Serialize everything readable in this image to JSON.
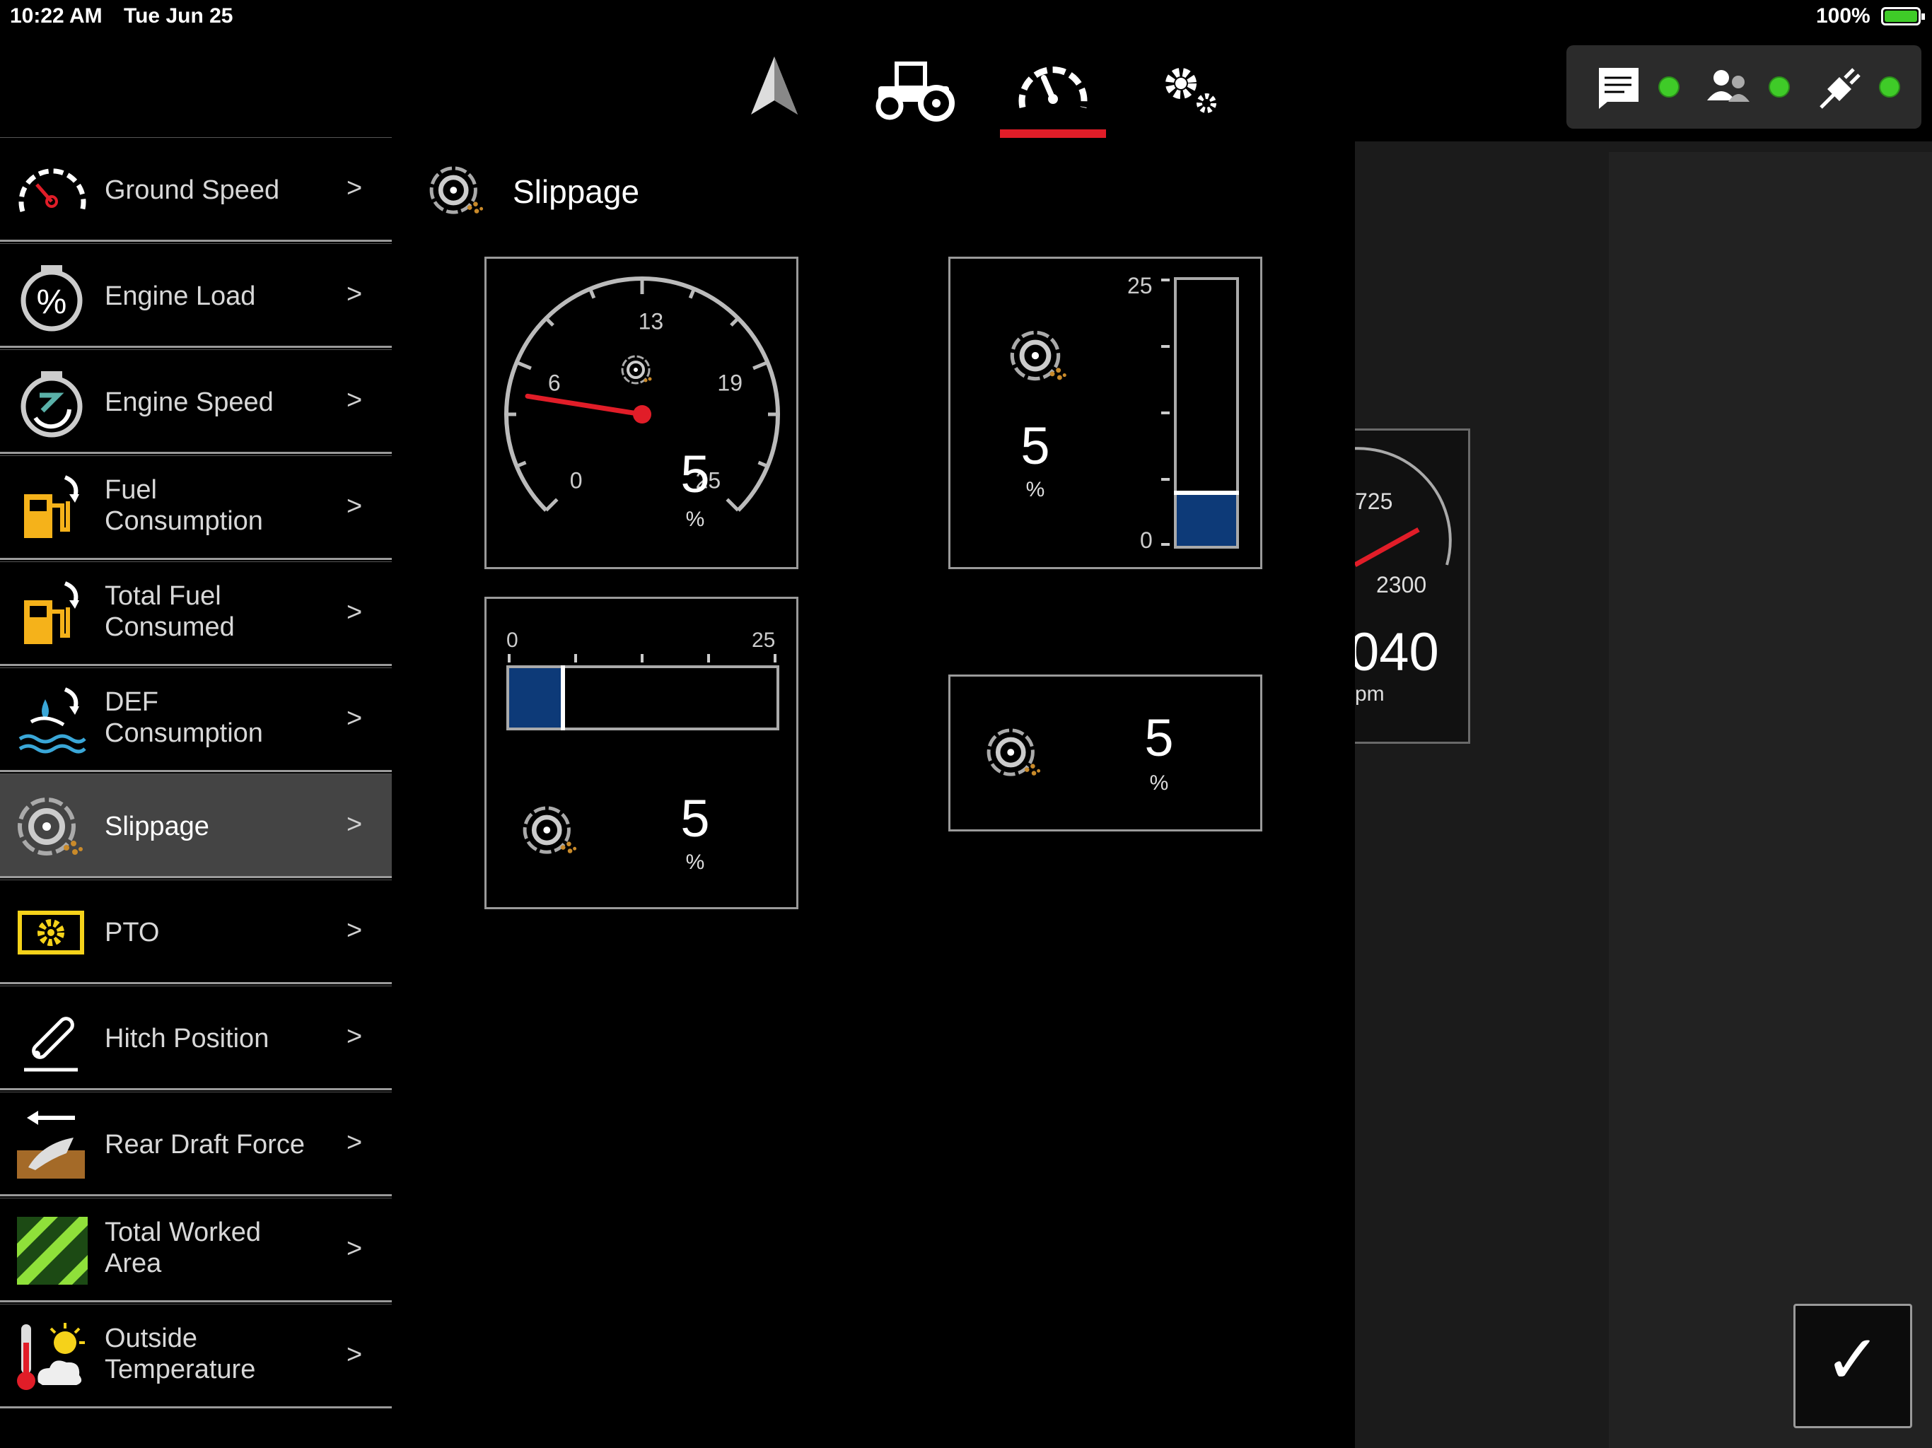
{
  "status_bar": {
    "time": "10:22 AM",
    "date": "Tue Jun 25",
    "battery": "100%"
  },
  "nav": {
    "tabs": [
      {
        "name": "navigation",
        "icon": "navigation-arrow-icon"
      },
      {
        "name": "tractor",
        "icon": "tractor-icon"
      },
      {
        "name": "performance",
        "icon": "speedometer-icon",
        "active": true
      },
      {
        "name": "settings",
        "icon": "gear-icon"
      }
    ],
    "connections": [
      {
        "icon": "message-icon",
        "status": "connected"
      },
      {
        "icon": "users-icon",
        "status": "connected"
      },
      {
        "icon": "plug-icon",
        "status": "connected"
      }
    ]
  },
  "sidebar": {
    "items": [
      {
        "label": "Ground Speed",
        "chevron": ">"
      },
      {
        "label": "Engine Load",
        "chevron": ">"
      },
      {
        "label": "Engine Speed",
        "chevron": ">"
      },
      {
        "label": "Fuel",
        "label2": "Consumption",
        "chevron": ">"
      },
      {
        "label": "Total Fuel",
        "label2": "Consumed",
        "chevron": ">"
      },
      {
        "label": "DEF",
        "label2": "Consumption",
        "chevron": ">"
      },
      {
        "label": "Slippage",
        "chevron": ">",
        "active": true
      },
      {
        "label": "PTO",
        "chevron": ">"
      },
      {
        "label": "Hitch Position",
        "chevron": ">"
      },
      {
        "label": "Rear Draft Force",
        "chevron": ">"
      },
      {
        "label": "Total Worked",
        "label2": "Area",
        "chevron": ">"
      },
      {
        "label": "Outside",
        "label2": "Temperature",
        "chevron": ">"
      }
    ]
  },
  "main": {
    "title": "Slippage",
    "dial_gauge": {
      "value": "5",
      "unit": "%",
      "ticks": [
        "0",
        "6",
        "13",
        "19",
        "25"
      ],
      "level": 5,
      "max": 25
    },
    "vertical_bar": {
      "value": "5",
      "unit": "%",
      "top_tick": "25",
      "bottom_tick": "0",
      "level": 5,
      "max": 25
    },
    "horizontal_bar": {
      "value": "5",
      "unit": "%",
      "left_tick": "0",
      "right_tick": "25",
      "level": 5,
      "max": 25
    },
    "numeric": {
      "value": "5",
      "unit": "%"
    }
  },
  "background_peek": {
    "tick_a": "725",
    "tick_b": "2300",
    "value": "040",
    "unit": "pm"
  },
  "confirm": {
    "symbol": "✓"
  },
  "colors": {
    "accent_red": "#e11d28",
    "bar_blue": "#0d3a78",
    "status_green": "#3fcb28",
    "fuel_yellow": "#f5b21a"
  }
}
